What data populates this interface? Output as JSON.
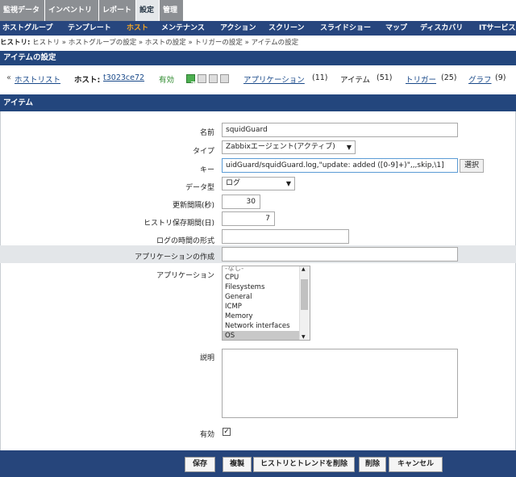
{
  "top_tabs": [
    "監視データ",
    "インベントリ",
    "レポート",
    "設定",
    "管理"
  ],
  "sub_nav": [
    "ホストグループ",
    "テンプレート",
    "ホスト",
    "メンテナンス",
    "アクション",
    "スクリーン",
    "スライドショー",
    "マップ",
    "ディスカバリ",
    "ITサービス"
  ],
  "breadcrumb": {
    "label": "ヒストリ:",
    "path": "ヒストリ » ホストグループの設定 » ホストの設定 » トリガーの設定 » アイテムの設定"
  },
  "item_settings_title": "アイテムの設定",
  "host_bar": {
    "host_list": "ホストリスト",
    "host_label": "ホスト:",
    "host_name": "t3023ce72",
    "enabled": "有効",
    "z_badge": "Z",
    "applications": "アプリケーション",
    "applications_count": "(11)",
    "items": "アイテム",
    "items_count": "(51)",
    "triggers": "トリガー",
    "triggers_count": "(25)",
    "graphs": "グラフ",
    "graphs_count": "(9)"
  },
  "section_title": "アイテム",
  "form": {
    "name_label": "名前",
    "name_value": "squidGuard",
    "type_label": "タイプ",
    "type_value": "Zabbixエージェント(アクティブ)",
    "key_label": "キー",
    "key_value": "uidGuard/squidGuard.log,\"update: added ([0-9]+)\",,,skip,\\1]",
    "select_button": "選択",
    "datatype_label": "データ型",
    "datatype_value": "ログ",
    "interval_label": "更新間隔(秒)",
    "interval_value": "30",
    "history_label": "ヒストリ保存期間(日)",
    "history_value": "7",
    "logformat_label": "ログの時間の形式",
    "logformat_value": "",
    "newapp_label": "アプリケーションの作成",
    "newapp_value": "",
    "apps_label": "アプリケーション",
    "apps_options": [
      "-なし-",
      "CPU",
      "Filesystems",
      "General",
      "ICMP",
      "Memory",
      "Network interfaces",
      "OS"
    ],
    "apps_selected": "OS",
    "description_label": "説明",
    "enabled_label": "有効",
    "enabled_checked": true
  },
  "footer_buttons": {
    "save": "保存",
    "clone": "複製",
    "clear_history": "ヒストリとトレンドを削除",
    "delete": "削除",
    "cancel": "キャンセル"
  }
}
